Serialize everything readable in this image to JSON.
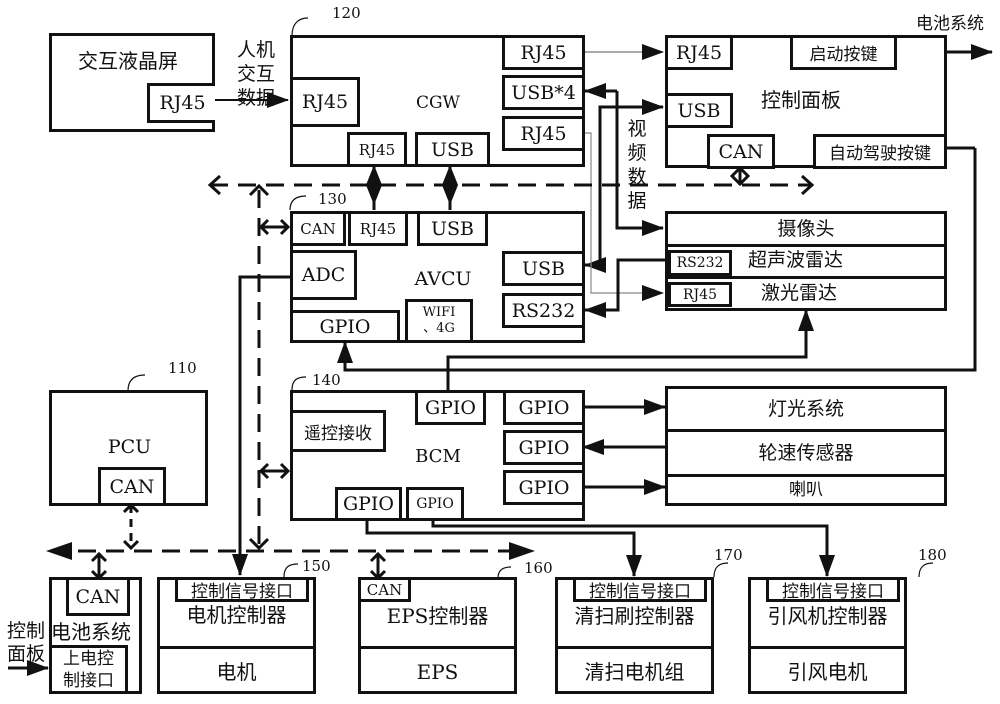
{
  "diagram": {
    "colors": {
      "line": "#111111",
      "thin_line": "#888888",
      "background": "#ffffff"
    },
    "refs": {
      "cgw": "120",
      "avcu": "130",
      "pcu": "110",
      "bcm": "140",
      "motor": "150",
      "eps": "160",
      "brush": "170",
      "fan": "180"
    },
    "lcd": {
      "title": "交互液晶屏",
      "port": "RJ45"
    },
    "hmi_label": [
      "人机",
      "交互",
      "数据"
    ],
    "cgw": {
      "title": "CGW",
      "ports": {
        "left_rj45": "RJ45",
        "right_rj45_top": "RJ45",
        "usb4": "USB*4",
        "right_rj45_bottom": "RJ45",
        "bottom_rj45": "RJ45",
        "bottom_usb": "USB"
      }
    },
    "panel": {
      "title": "控制面板",
      "ports": {
        "rj45": "RJ45",
        "start_key": "启动按键",
        "usb": "USB",
        "can": "CAN",
        "auto_key": "自动驾驶按键"
      },
      "output_label": "电池系统"
    },
    "video_label": [
      "视",
      "频",
      "数",
      "据"
    ],
    "avcu": {
      "title": "AVCU",
      "ports": {
        "can": "CAN",
        "rj45": "RJ45",
        "usb_top": "USB",
        "adc": "ADC",
        "usb_right": "USB",
        "rs232": "RS232",
        "gpio": "GPIO",
        "wifi": "WIFI",
        "wifi2": "、4G"
      }
    },
    "sensors": {
      "camera": "摄像头",
      "ultrasonic": "超声波雷达",
      "ultrasonic_port": "RS232",
      "lidar": "激光雷达",
      "lidar_port": "RJ45"
    },
    "pcu": {
      "title": "PCU",
      "port": "CAN"
    },
    "bcm": {
      "title": "BCM",
      "remote": "遥控接收",
      "gpio_top": "GPIO",
      "gpio_r1": "GPIO",
      "gpio_r2": "GPIO",
      "gpio_r3": "GPIO",
      "gpio_b1": "GPIO",
      "gpio_b2": "GPIO"
    },
    "peripherals": {
      "light": "灯光系统",
      "wheel_speed": "轮速传感器",
      "horn": "喇叭"
    },
    "battery": {
      "port": "CAN",
      "title": "电池系统",
      "power_port": "上电控\n制接口",
      "power_port_l1": "上电控",
      "power_port_l2": "制接口",
      "input_label_l1": "控制",
      "input_label_l2": "面板"
    },
    "motor": {
      "port": "控制信号接口",
      "controller": "电机控制器",
      "device": "电机"
    },
    "eps": {
      "port": "CAN",
      "controller": "EPS控制器",
      "device": "EPS"
    },
    "brush": {
      "port": "控制信号接口",
      "controller": "清扫刷控制器",
      "device": "清扫电机组"
    },
    "fan": {
      "port": "控制信号接口",
      "controller": "引风机控制器",
      "device": "引风电机"
    }
  }
}
